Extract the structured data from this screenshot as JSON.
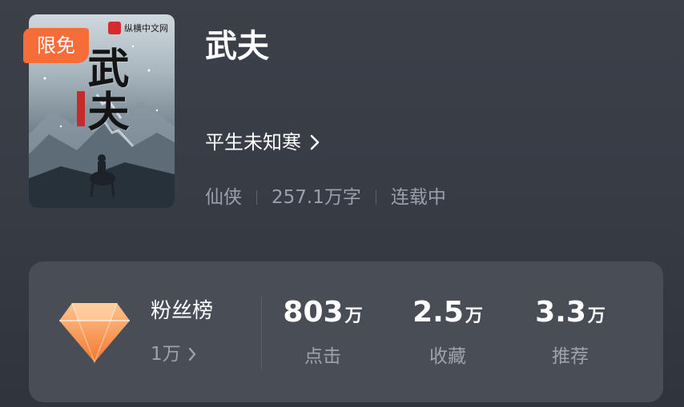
{
  "book": {
    "cover_title": "武夫",
    "publisher": "纵横中文网",
    "badge": "限免",
    "title": "武夫",
    "author": "平生未知寒",
    "genre": "仙侠",
    "word_count": "257.1万字",
    "status": "连载中"
  },
  "stats": {
    "fans": {
      "label": "粉丝榜",
      "value": "1万"
    },
    "clicks": {
      "value": "803",
      "unit": "万",
      "label": "点击"
    },
    "favorites": {
      "value": "2.5",
      "unit": "万",
      "label": "收藏"
    },
    "recommends": {
      "value": "3.3",
      "unit": "万",
      "label": "推荐"
    }
  },
  "icons": {
    "author_arrow": "chevron-right-icon",
    "fans_arrow": "chevron-right-icon",
    "fans_badge": "diamond-icon"
  },
  "colors": {
    "badge": "#f76d3a",
    "gem_top": "#ffc48f",
    "gem_bottom": "#f2782f",
    "card": "#484d56"
  }
}
